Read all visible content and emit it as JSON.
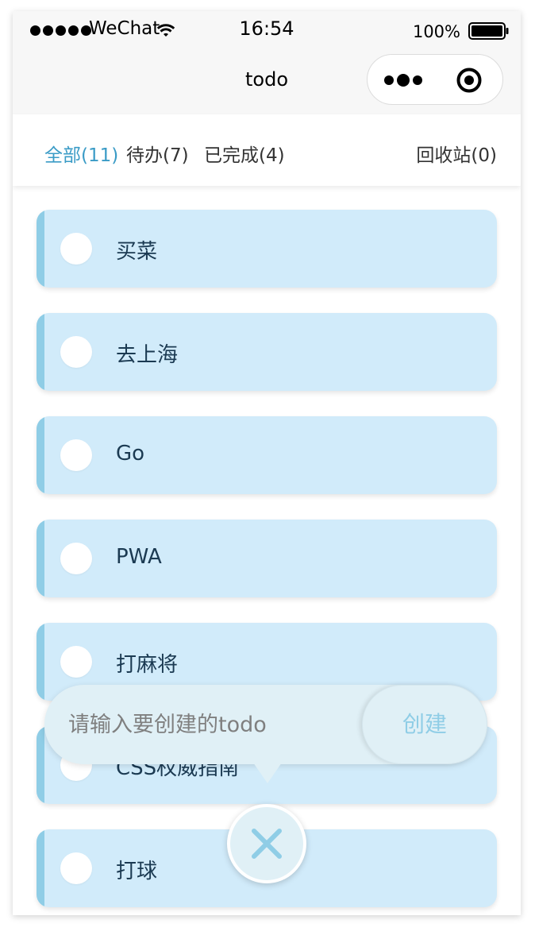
{
  "status_bar": {
    "carrier": "WeChat",
    "time": "16:54",
    "battery": "100%"
  },
  "nav": {
    "title": "todo"
  },
  "tabs": [
    {
      "label": "全部(11)",
      "active": true
    },
    {
      "label": "待办(7)",
      "active": false
    },
    {
      "label": "已完成(4)",
      "active": false
    },
    {
      "label": "回收站(0)",
      "active": false
    }
  ],
  "todos": [
    {
      "label": "买菜"
    },
    {
      "label": "去上海"
    },
    {
      "label": "Go"
    },
    {
      "label": "PWA"
    },
    {
      "label": "打麻将"
    },
    {
      "label": "CSS权威指南"
    },
    {
      "label": "打球"
    }
  ],
  "create": {
    "placeholder": "请输入要创建的todo",
    "button_label": "创建"
  },
  "colors": {
    "accent": "#3a9bc6",
    "item_bg": "#d1ebfa",
    "item_bar": "#8fcde6",
    "popup_bg": "#e0f0f6"
  }
}
